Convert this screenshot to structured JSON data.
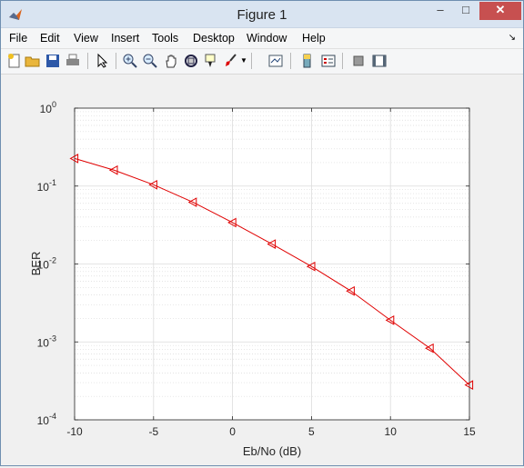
{
  "window": {
    "title": "Figure 1"
  },
  "menu": [
    "File",
    "Edit",
    "View",
    "Insert",
    "Tools",
    "Desktop",
    "Window",
    "Help"
  ],
  "toolbar": [
    "new-figure",
    "open-file",
    "save",
    "print",
    "edit-plot",
    "zoom-in",
    "zoom-out",
    "pan",
    "rotate-3d",
    "data-cursor",
    "brush",
    "link-plot",
    "insert-colorbar",
    "insert-legend",
    "hide-plot-tools",
    "show-plot-tools"
  ],
  "chart_data": {
    "type": "line",
    "xlabel": "Eb/No (dB)",
    "ylabel": "BER",
    "xlim": [
      -10,
      15
    ],
    "ylim": [
      0.0001,
      1
    ],
    "yscale": "log",
    "grid": true,
    "x_ticks": [
      "-10",
      "-5",
      "0",
      "5",
      "10",
      "15"
    ],
    "y_ticks": [
      {
        "base": "10",
        "exp": "0"
      },
      {
        "base": "10",
        "exp": "-1"
      },
      {
        "base": "10",
        "exp": "-2"
      },
      {
        "base": "10",
        "exp": "-3"
      },
      {
        "base": "10",
        "exp": "-4"
      }
    ],
    "series": [
      {
        "color": "#e00000",
        "marker": "triangle-left",
        "x": [
          -10,
          -7.5,
          -5,
          -2.5,
          0,
          2.5,
          5,
          7.5,
          10,
          12.5,
          15
        ],
        "y": [
          0.226,
          0.16,
          0.104,
          0.062,
          0.034,
          0.018,
          0.0093,
          0.0045,
          0.0019,
          0.00083,
          0.00028
        ]
      }
    ]
  }
}
